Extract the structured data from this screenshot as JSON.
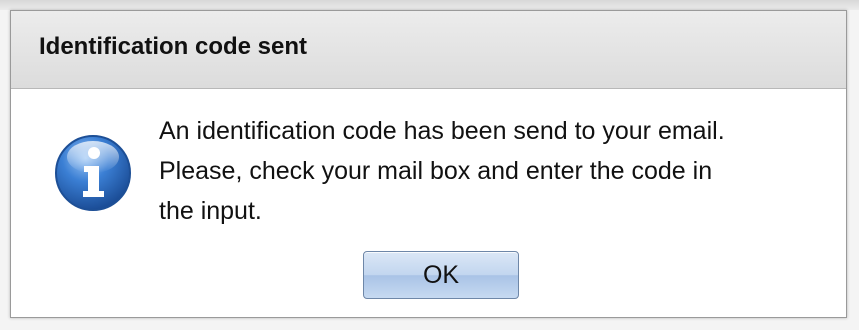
{
  "dialog": {
    "title": "Identification code sent",
    "message_lines": [
      "An identification code has been send to your email.",
      "Please, check your mail box and enter the code in",
      "the input."
    ],
    "icon": "info-icon",
    "ok_label": "OK"
  },
  "colors": {
    "icon_blue": "#2f6fc4",
    "button_blue": "#c2d6ef",
    "title_bar": "#e4e4e4"
  }
}
